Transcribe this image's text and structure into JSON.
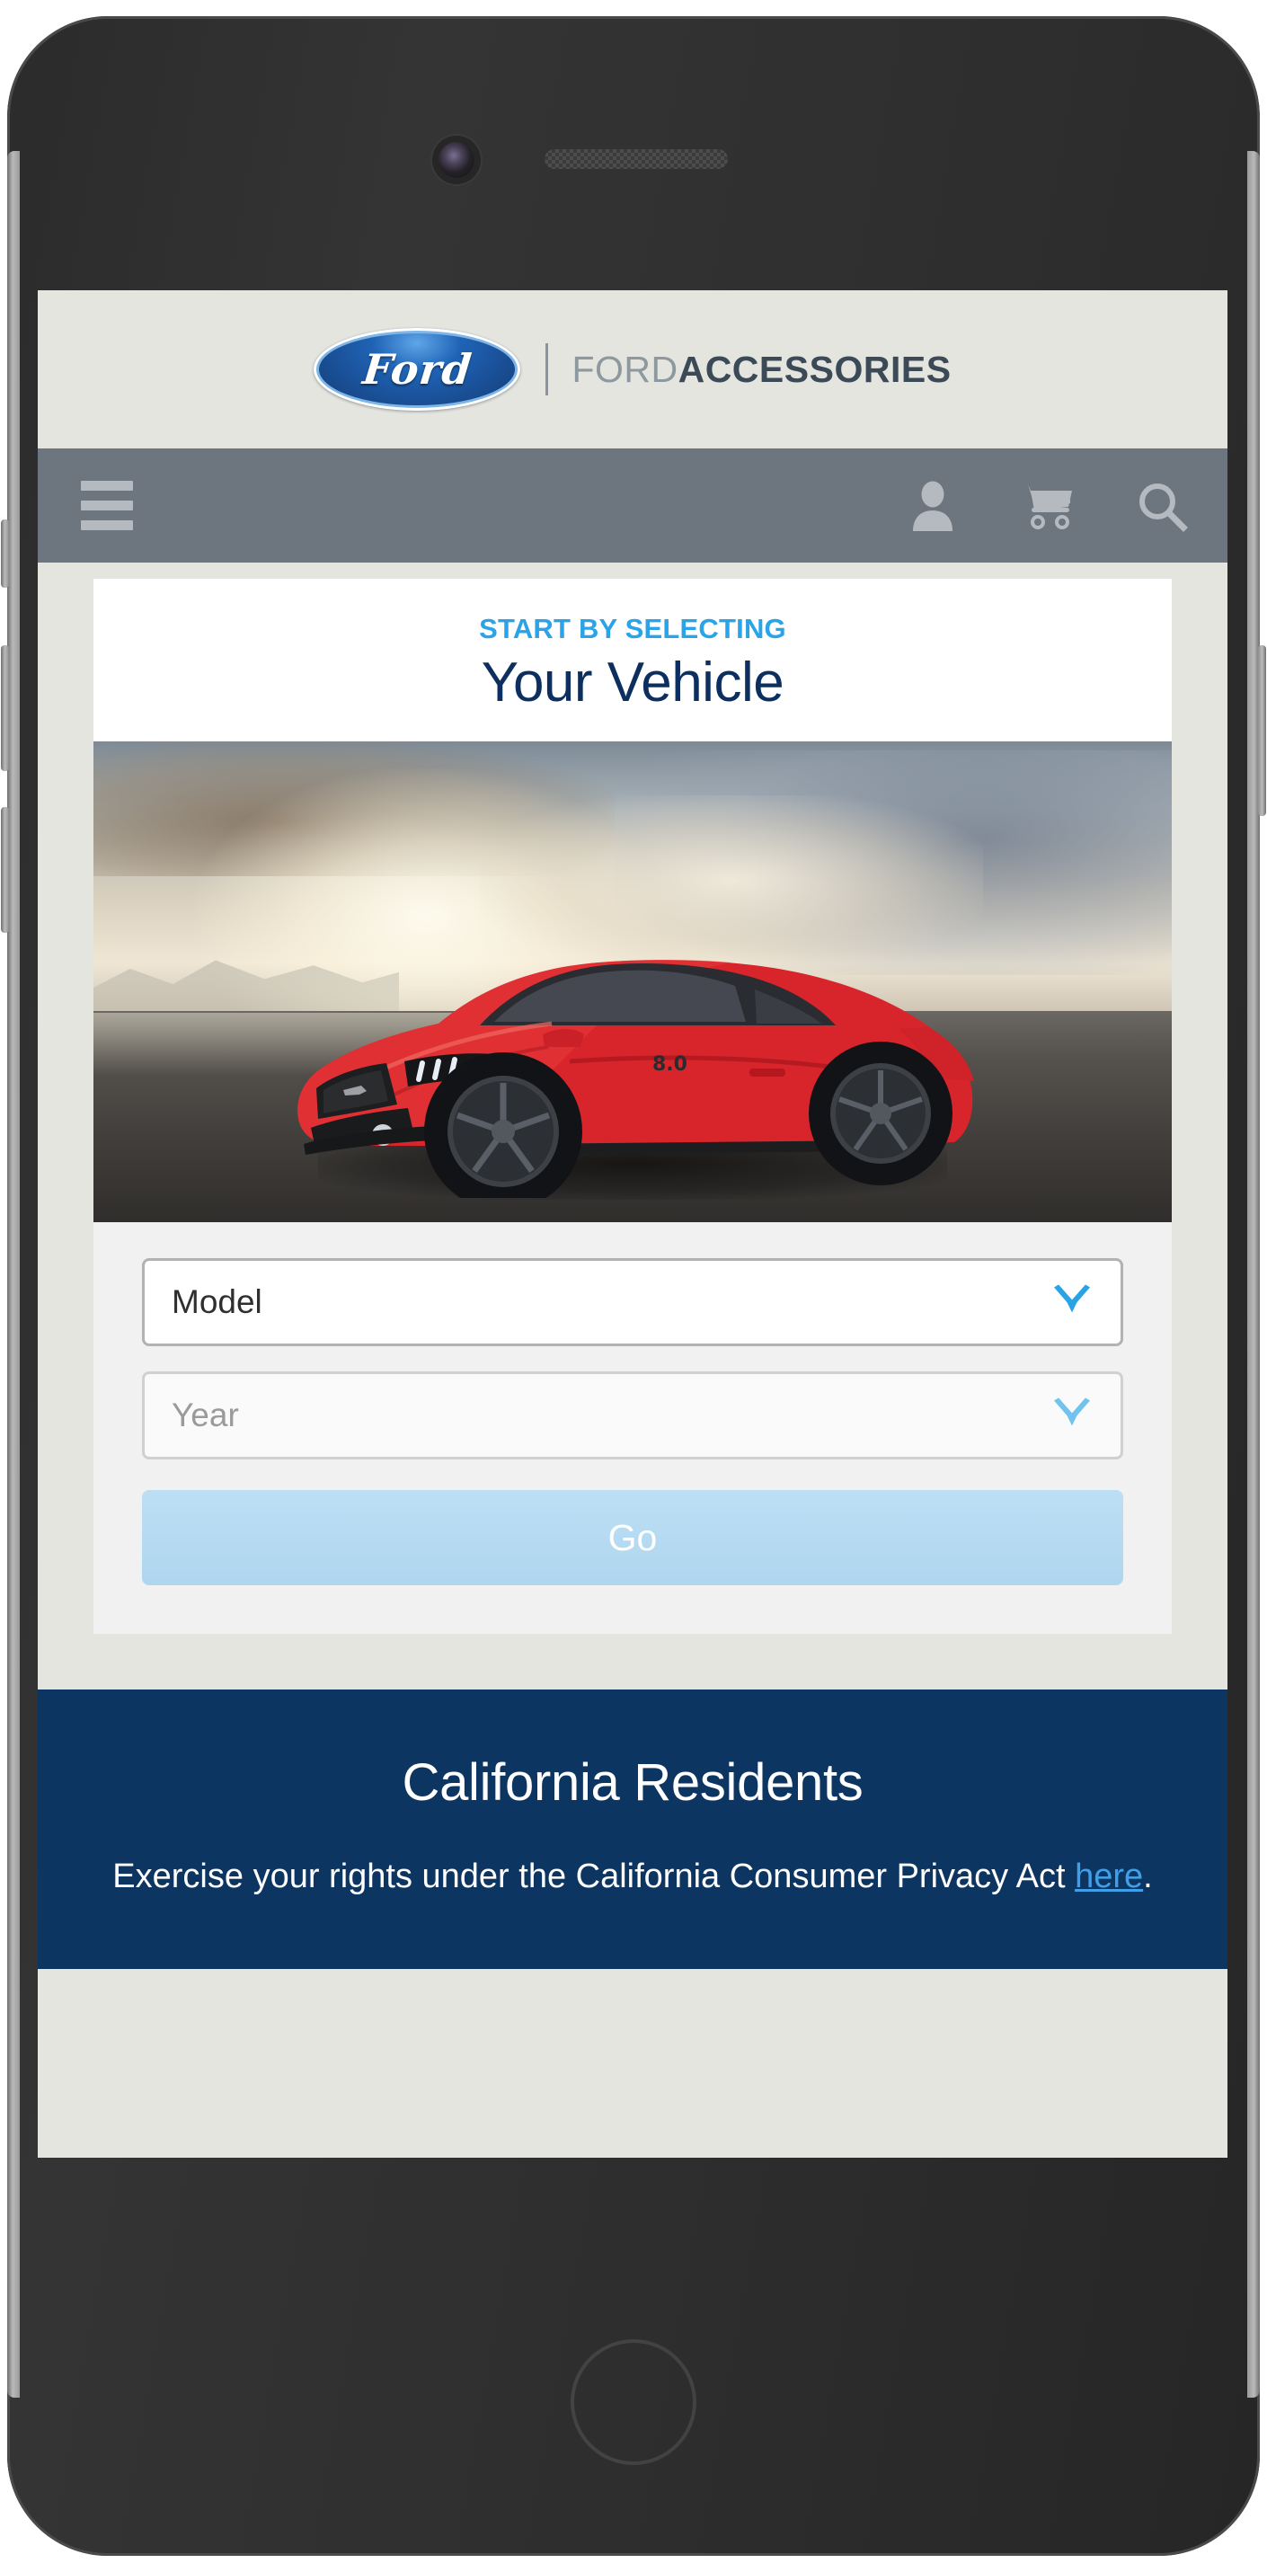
{
  "device": {
    "camera_icon": "front-camera-icon",
    "speaker_icon": "speaker-grille-icon",
    "home_button_label": "Home",
    "buttons": [
      "silent-switch",
      "volume-up",
      "volume-down",
      "power"
    ]
  },
  "header": {
    "logo_alt": "Ford",
    "logo_wordmark": "Ford",
    "brand_light": "FORD",
    "brand_bold": "ACCESSORIES"
  },
  "nav": {
    "menu_icon": "hamburger-menu-icon",
    "account_icon": "person-icon",
    "cart_icon": "shopping-cart-icon",
    "search_icon": "search-icon"
  },
  "hero": {
    "eyebrow": "START BY SELECTING",
    "headline": "Your Vehicle",
    "image_alt": "Red Ford Mustang GT on a desert road at sunset"
  },
  "selector": {
    "model": {
      "value": "Model",
      "placeholder": "Model",
      "chevron_icon": "chevron-down-icon"
    },
    "year": {
      "value": "Year",
      "placeholder": "Year",
      "chevron_icon": "chevron-down-icon",
      "disabled": true
    },
    "go_label": "Go",
    "go_disabled": true
  },
  "california": {
    "title": "California Residents",
    "body_before": "Exercise your rights under the California Consumer Privacy Act ",
    "link_text": "here",
    "body_after": "."
  },
  "colors": {
    "brand_blue": "#0d3562",
    "accent_blue": "#2aa3e8",
    "link_blue": "#3f9fe8",
    "nav_gray": "#6d757e",
    "page_bg": "#e5e5e0",
    "form_bg": "#f1f1f1",
    "go_button": "#b5dbf1",
    "accessories_bold": "#3c4a57",
    "accessories_light": "#8e989f"
  }
}
